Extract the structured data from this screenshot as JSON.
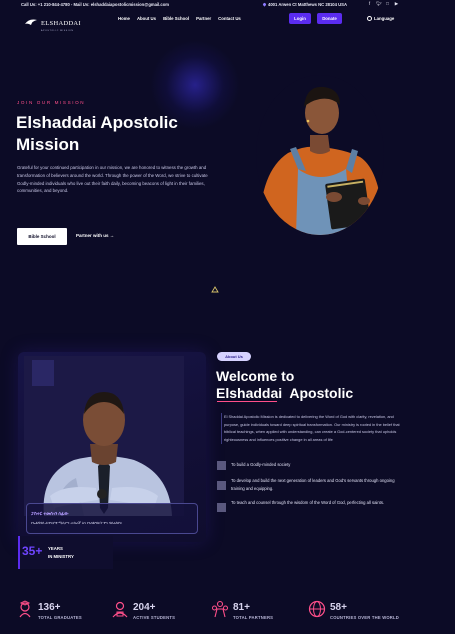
{
  "topbar": {
    "contact": "Call Us: +1 210-844-4780 - Mail Us: elshaddaiapostolicmission@gmail.com",
    "address": "4001 Arwen Ct Matthews NC 28104 USA",
    "socials": [
      "f",
      "t",
      "ig",
      "yt"
    ]
  },
  "nav": {
    "logo_name": "ELSHADDAI",
    "logo_sub": "APOSTOLIC MISSION",
    "links": [
      "Home",
      "About Us",
      "Bible School",
      "Partner",
      "Contact Us"
    ],
    "login": "Login",
    "donate": "Donate",
    "language": "Language"
  },
  "hero": {
    "eyebrow": "JOIN OUR MISSION",
    "title": "Elshaddai Apostolic Mission",
    "text": "Grateful for your continued participation in our mission, we are honored to witness the growth and transformation of believers around the world. Through the power of the Word, we strive to cultivate Godly-minded individuals who live out their faith daily, becoming beacons of light in their families, communities, and beyond.",
    "btn_school": "Bible School",
    "partner_link": "Partner with us →"
  },
  "about": {
    "pill": "About Us",
    "title_1": "Welcome to",
    "title_2": "Elshaddai  Apostolic",
    "text": "El Shaddai Apostolic Mission is dedicated to delivering the Word of God with clarity, revelation, and purpose, guide individuals toward deep spiritual transformation. Our ministry is rooted in the belief that biblical teachings, when applied with understanding, can create a God-centered society that upholds righteousness and influences positive change in all areas of life",
    "items": [
      "To build a Godly-minded society",
      "To develop and build the next generation of leaders and God's servants through ongoing training and equipping.",
      "To teach and counsel through the wisdom of the Word of God, perfecting all saints."
    ],
    "pastor_name": "ፓስተር ተመስገን ሰፊው",
    "pastor_role": "የኤልሻዳይ ሐዋርያዊ ሚሲዮን መስራች እና የአገልግሎት ዋና ዳይሬክተር",
    "years_num": "35+",
    "years_label_1": "YEARS",
    "years_label_2": "IN MINISTRY"
  },
  "stats": [
    {
      "num": "136+",
      "label": "TOTAL GRADUATES",
      "icon": "graduate-icon"
    },
    {
      "num": "204+",
      "label": "ACTIVE STUDENTS",
      "icon": "students-icon"
    },
    {
      "num": "81+",
      "label": "TOTAL PARTNERS",
      "icon": "partners-icon"
    },
    {
      "num": "58+",
      "label": "COUNTRIES OVER THE WORLD",
      "icon": "globe-icon"
    }
  ],
  "colors": {
    "background": "#0c0b26",
    "accent": "#5b2cf0",
    "eyebrow": "#ff4f8a",
    "stat_icon": "#ff4f8a"
  }
}
